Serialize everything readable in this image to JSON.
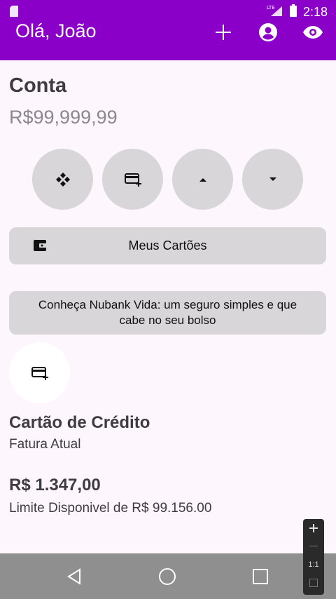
{
  "status_bar": {
    "time": "2:18",
    "network": "LTE"
  },
  "app_bar": {
    "title": "Olá, João",
    "icons": [
      "add-icon",
      "account-circle-icon",
      "eye-icon"
    ]
  },
  "account": {
    "heading": "Conta",
    "balance": "R$99,999,99",
    "action_icons": [
      "pix-icon",
      "card-add-icon",
      "arrow-up-icon",
      "arrow-down-icon"
    ]
  },
  "my_cards_label": "Meus Cartões",
  "promo_text": "Conheça Nubank Vida: um seguro simples e que cabe no seu bolso",
  "credit_card": {
    "title": "Cartão de Crédito",
    "subtitle": "Fatura Atual",
    "amount": "R$ 1.347,00",
    "limit": "Limite Disponivel de R$ 99.156.00"
  },
  "zoom_controls": {
    "ratio": "1:1"
  },
  "colors": {
    "primary": "#8a00c8",
    "background": "#fdf6fd",
    "button_gray": "#d8d6d9",
    "nav_bar": "#8f8f8f"
  }
}
